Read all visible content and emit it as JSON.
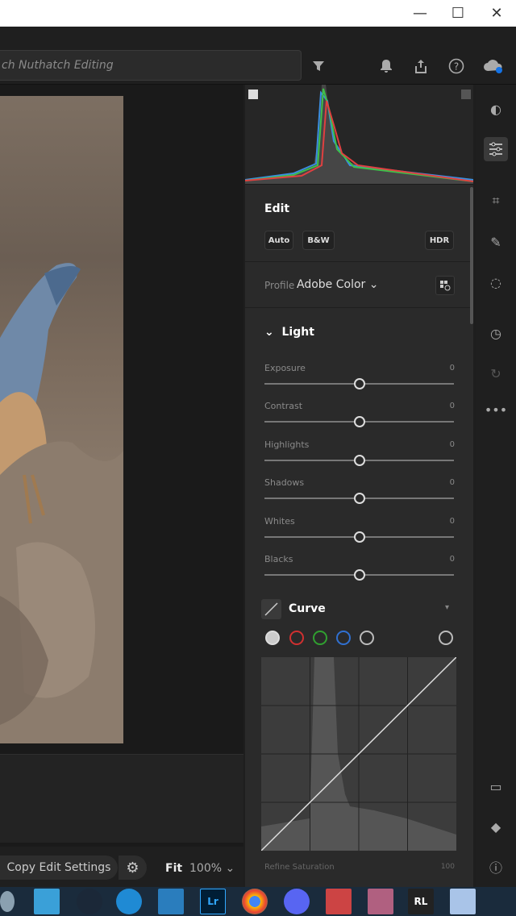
{
  "titlebar": {
    "minimize": "—",
    "maximize": "☐",
    "close": "✕"
  },
  "search": {
    "placeholder": "ch Nuthatch Editing"
  },
  "edit": {
    "heading": "Edit",
    "auto_label": "Auto",
    "bw_label": "B&W",
    "hdr_label": "HDR",
    "profile_label": "Profile",
    "profile_value": "Adobe Color"
  },
  "light": {
    "heading": "Light",
    "sliders": [
      {
        "label": "Exposure",
        "value": "0",
        "position": 0.5
      },
      {
        "label": "Contrast",
        "value": "0",
        "position": 0.5
      },
      {
        "label": "Highlights",
        "value": "0",
        "position": 0.5
      },
      {
        "label": "Shadows",
        "value": "0",
        "position": 0.5
      },
      {
        "label": "Whites",
        "value": "0",
        "position": 0.5
      },
      {
        "label": "Blacks",
        "value": "0",
        "position": 0.5
      }
    ]
  },
  "curve": {
    "heading": "Curve",
    "refine_label": "Refine Saturation",
    "refine_value": "100"
  },
  "bottom": {
    "copy_label": "Copy Edit Settings",
    "fit_label": "Fit",
    "zoom_label": "100%"
  },
  "colors": {
    "accent": "#1473e6",
    "panel": "#2a2a2a",
    "background": "#1e1e1e"
  }
}
